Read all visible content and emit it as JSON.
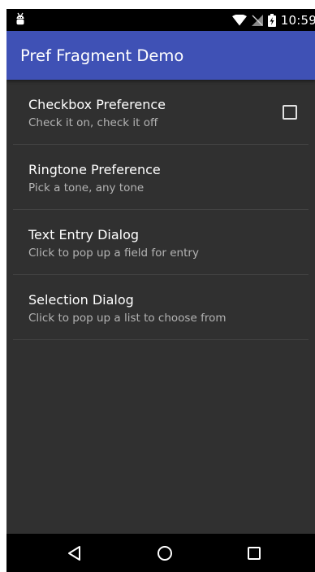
{
  "status_bar": {
    "time": "10:59",
    "icons": [
      "android-debug-icon",
      "wifi-icon",
      "signal-off-icon",
      "battery-charging-icon"
    ]
  },
  "app_bar": {
    "title": "Pref Fragment Demo",
    "color": "#3f51b5"
  },
  "preferences": [
    {
      "title": "Checkbox Preference",
      "summary": "Check it on, check it off",
      "type": "checkbox",
      "checked": false
    },
    {
      "title": "Ringtone Preference",
      "summary": "Pick a tone, any tone",
      "type": "ringtone"
    },
    {
      "title": "Text Entry Dialog",
      "summary": "Click to pop up a field for entry",
      "type": "text"
    },
    {
      "title": "Selection Dialog",
      "summary": "Click to pop up a list to choose from",
      "type": "list"
    }
  ],
  "nav_bar": {
    "buttons": [
      "back-icon",
      "home-icon",
      "recents-icon"
    ]
  },
  "colors": {
    "background": "#303030",
    "divider": "#424242",
    "summary_text": "#b3b3b3"
  }
}
